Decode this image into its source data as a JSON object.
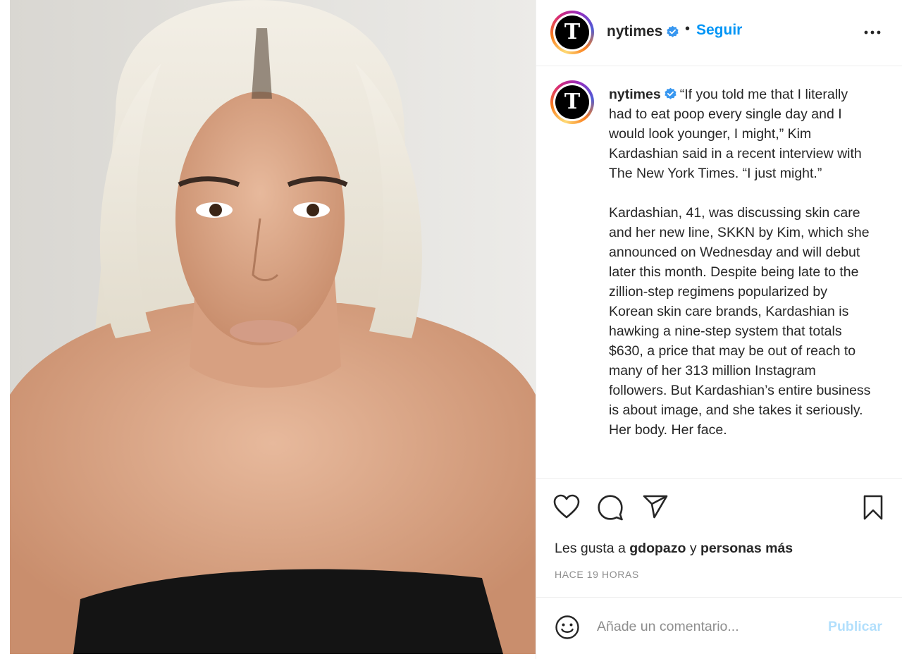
{
  "post": {
    "image_alt": "Portrait photograph",
    "header": {
      "username": "nytimes",
      "follow_label": "Seguir",
      "separator": "•",
      "avatar_glyph": "T"
    },
    "caption": {
      "username": "nytimes",
      "text": "“If you told me that I literally had to eat poop every single day and I would look younger, I might,” Kim Kardashian said in a recent interview with The New York Times. “I just might.”\n\nKardashian, 41, was discussing skin care and her new line, SKKN by Kim, which she announced on Wednesday and will debut later this month. Despite being late to the zillion-step regimens popularized by Korean skin care brands, Kardashian is hawking a nine-step system that totals $630, a price that may be out of reach to many of her 313 million Instagram followers. But Kardashian’s entire business is about image, and she takes it seriously. Her body. Her face."
    },
    "actions": {
      "icons": [
        "heart-icon",
        "comment-icon",
        "share-icon",
        "bookmark-icon"
      ]
    },
    "likes": {
      "prefix": "Les gusta a",
      "user": "gdopazo",
      "conjunction": "y",
      "others": "personas más"
    },
    "timestamp": "HACE 19 HORAS",
    "comment": {
      "placeholder": "Añade un comentario...",
      "publish_label": "Publicar"
    },
    "colors": {
      "accent": "#0095f6",
      "publish_disabled": "#b2dffc",
      "verified": "#3897f0",
      "muted": "#8e8e8e"
    }
  }
}
